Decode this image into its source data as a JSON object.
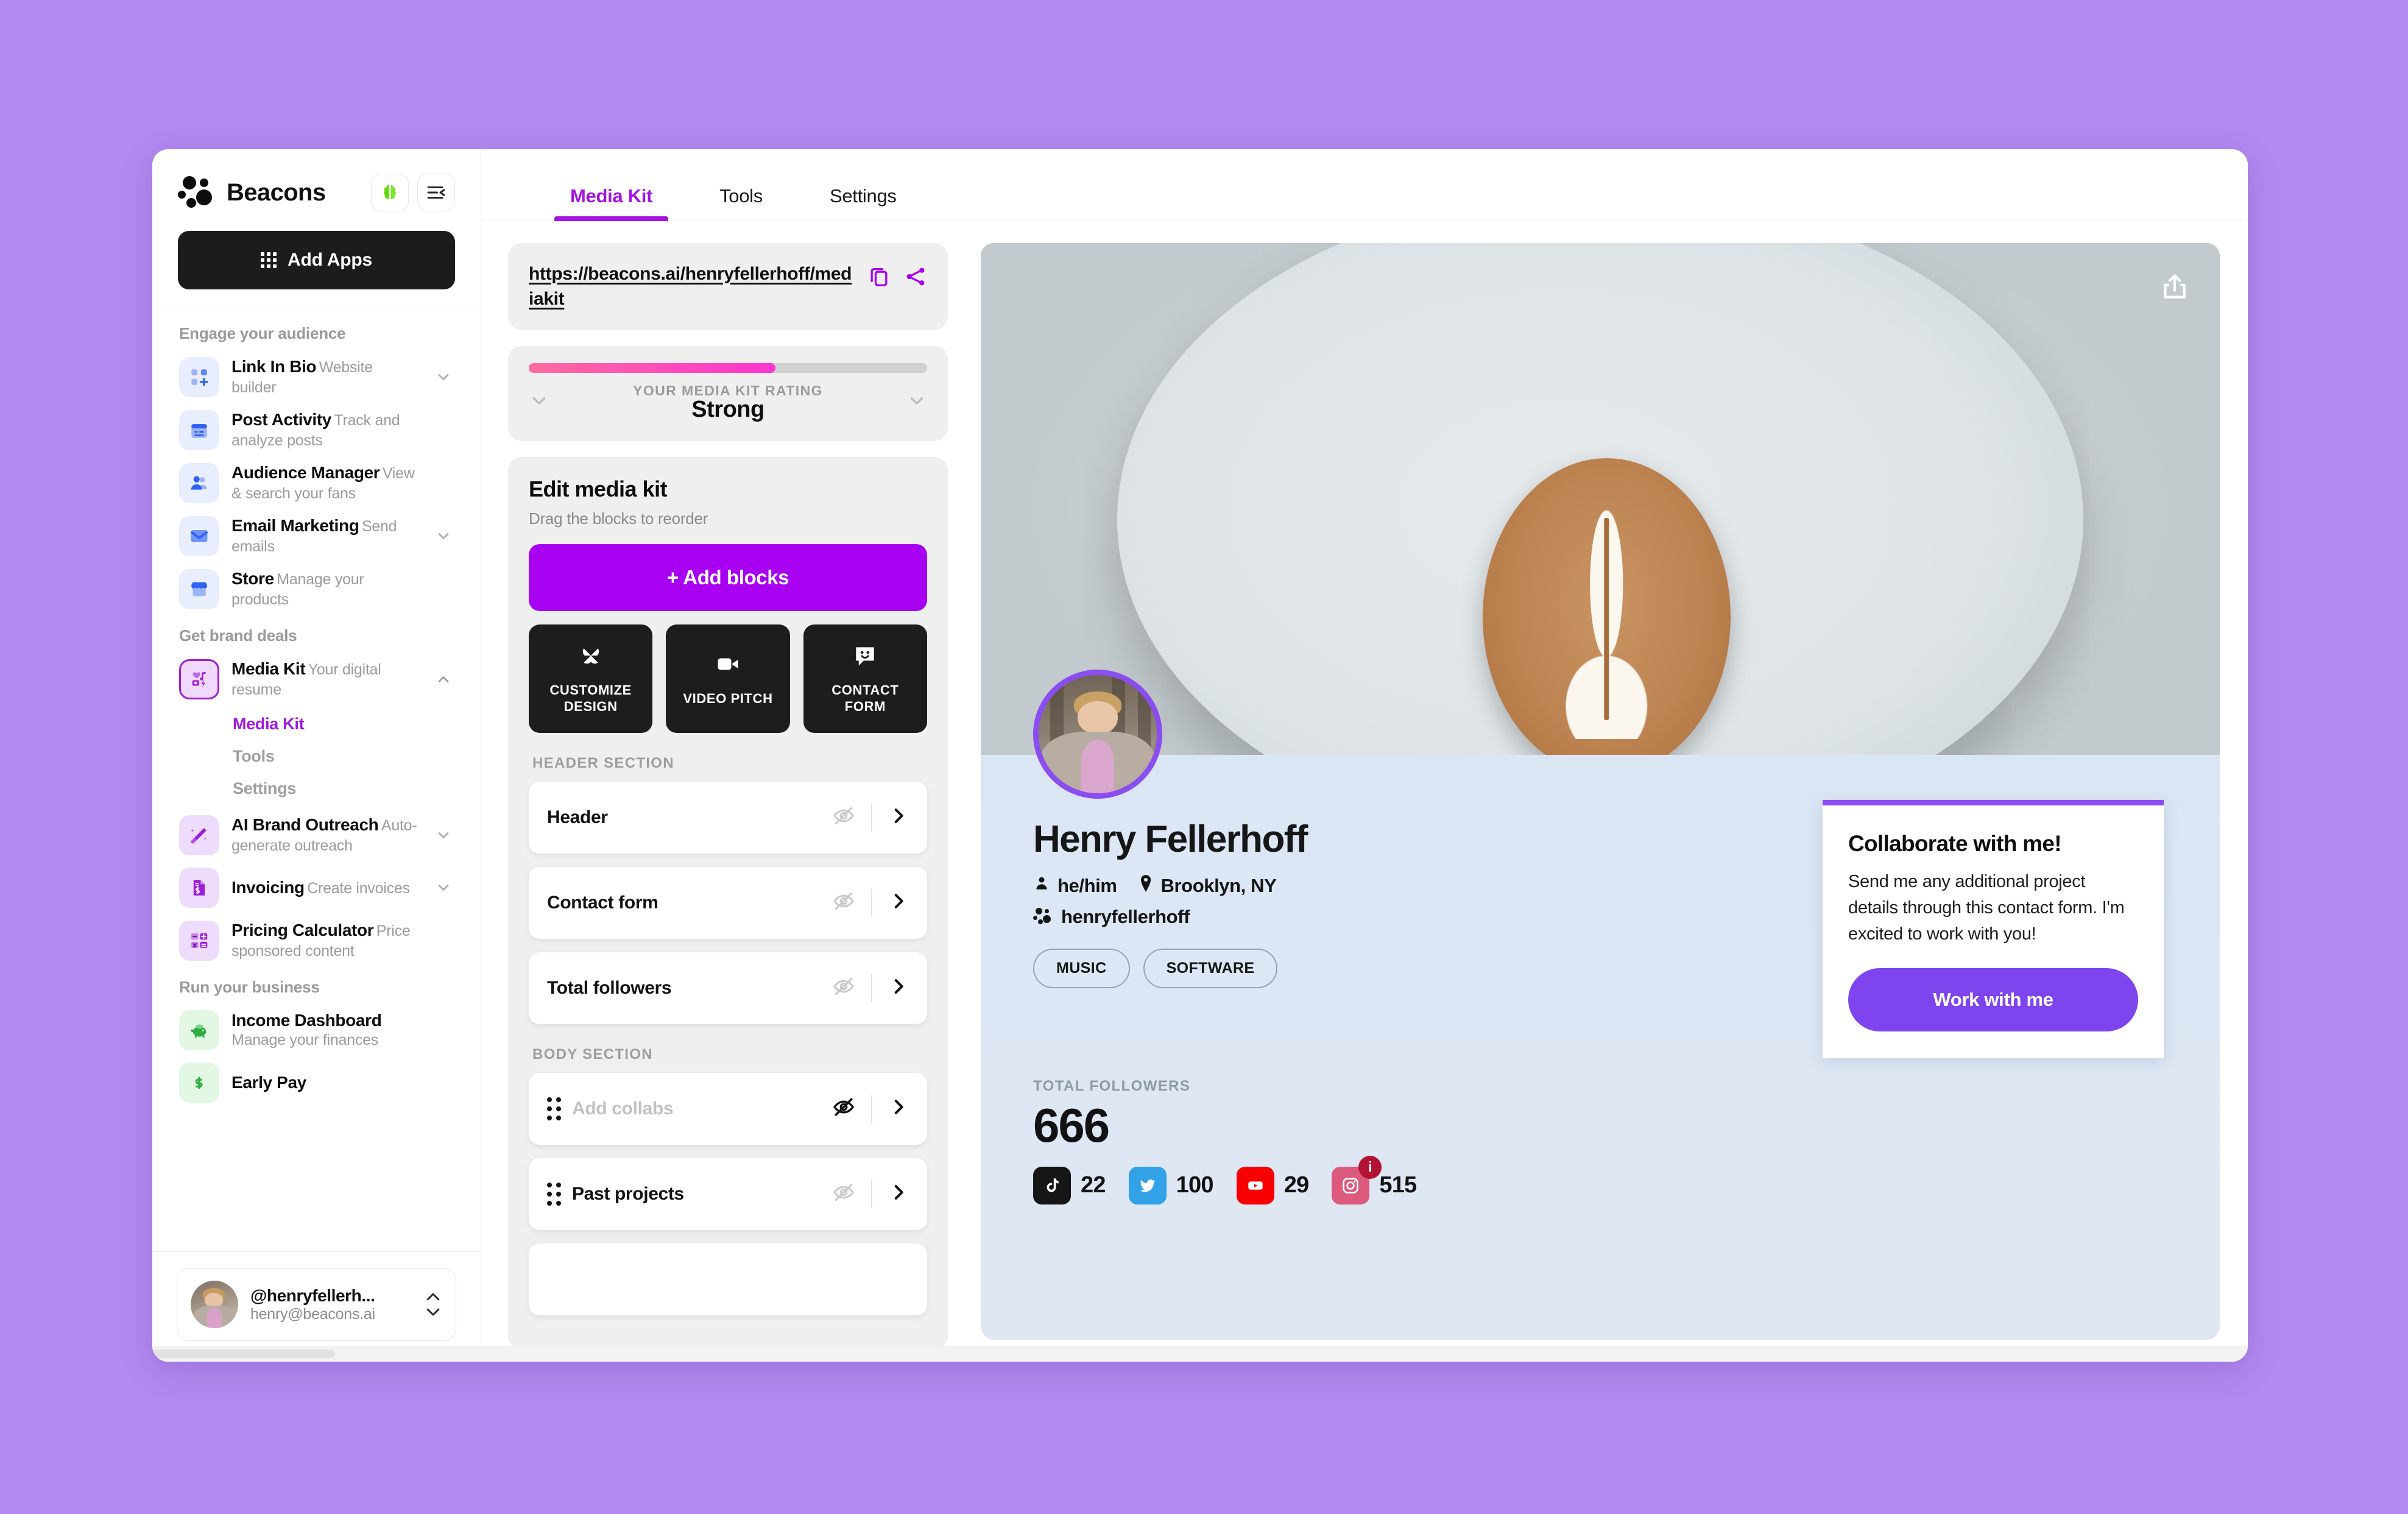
{
  "brand": {
    "name": "Beacons",
    "brain_icon": "brain-icon",
    "collapse_icon": "collapse-sidebar-icon"
  },
  "add_apps": {
    "label": "Add Apps",
    "icon": "grid-apps-icon"
  },
  "sidebar": {
    "groups": [
      {
        "title": "Engage your audience",
        "items": [
          {
            "label": "Link In Bio",
            "sub": "Website builder",
            "icon": "link-in-bio-icon",
            "tone": "blue",
            "chevron": "chevron-down-icon"
          },
          {
            "label": "Post Activity",
            "sub": "Track and analyze posts",
            "icon": "calendar-post-icon",
            "tone": "blue",
            "chevron": ""
          },
          {
            "label": "Audience Manager",
            "sub": "View & search your fans",
            "icon": "people-icon",
            "tone": "blue",
            "chevron": ""
          },
          {
            "label": "Email Marketing",
            "sub": "Send emails",
            "icon": "envelope-icon",
            "tone": "blue",
            "chevron": "chevron-down-icon"
          },
          {
            "label": "Store",
            "sub": "Manage your products",
            "icon": "storefront-icon",
            "tone": "blue",
            "chevron": ""
          }
        ]
      },
      {
        "title": "Get brand deals",
        "items": [
          {
            "label": "Media Kit",
            "sub": "Your digital resume",
            "icon": "media-kit-icon",
            "tone": "active",
            "chevron": "chevron-up-icon",
            "sublinks": [
              {
                "label": "Media Kit",
                "active": true
              },
              {
                "label": "Tools",
                "active": false
              },
              {
                "label": "Settings",
                "active": false
              }
            ]
          },
          {
            "label": "AI Brand Outreach",
            "sub": "Auto-generate outreach",
            "icon": "magic-wand-icon",
            "tone": "purple",
            "chevron": "chevron-down-icon"
          },
          {
            "label": "Invoicing",
            "sub": "Create invoices",
            "icon": "invoice-icon",
            "tone": "purple",
            "chevron": "chevron-down-icon"
          },
          {
            "label": "Pricing Calculator",
            "sub": "Price sponsored content",
            "icon": "calculator-icon",
            "tone": "purple",
            "chevron": ""
          }
        ]
      },
      {
        "title": "Run your business",
        "items": [
          {
            "label": "Income Dashboard",
            "sub": "Manage your finances",
            "icon": "piggy-bank-icon",
            "tone": "green",
            "chevron": ""
          },
          {
            "label": "Early Pay",
            "sub": "",
            "icon": "dollar-icon",
            "tone": "green",
            "chevron": ""
          }
        ]
      }
    ],
    "user": {
      "handle": "@henryfellerh...",
      "email": "henry@beacons.ai",
      "avatar": "user-avatar",
      "stepper_icon": "up-down-chevrons-icon"
    }
  },
  "tabs": [
    {
      "label": "Media Kit",
      "active": true
    },
    {
      "label": "Tools",
      "active": false
    },
    {
      "label": "Settings",
      "active": false
    }
  ],
  "editor": {
    "url": "https://beacons.ai/henryfellerhoff/mediakit",
    "copy_icon": "copy-icon",
    "share_icon": "share-nodes-icon",
    "rating": {
      "label": "YOUR MEDIA KIT RATING",
      "value": "Strong",
      "percent": 62,
      "left_icon": "chevron-down-icon",
      "right_icon": "chevron-down-icon"
    },
    "edit": {
      "title": "Edit media kit",
      "subtitle": "Drag the blocks to reorder",
      "add_blocks_label": "+ Add blocks",
      "quick_actions": [
        {
          "label": "CUSTOMIZE DESIGN",
          "icon": "brush-icon"
        },
        {
          "label": "VIDEO PITCH",
          "icon": "video-camera-icon"
        },
        {
          "label": "CONTACT FORM",
          "icon": "chat-smile-icon"
        }
      ]
    },
    "sections": [
      {
        "label": "HEADER SECTION",
        "blocks": [
          {
            "name": "Header",
            "draggable": false,
            "hidden_icon": "eye-slash-icon",
            "hidden_strong": false,
            "muted": false,
            "arrow_icon": "chevron-right-icon"
          },
          {
            "name": "Contact form",
            "draggable": false,
            "hidden_icon": "eye-slash-icon",
            "hidden_strong": false,
            "muted": false,
            "arrow_icon": "chevron-right-icon"
          },
          {
            "name": "Total followers",
            "draggable": false,
            "hidden_icon": "eye-slash-icon",
            "hidden_strong": false,
            "muted": false,
            "arrow_icon": "chevron-right-icon"
          }
        ]
      },
      {
        "label": "BODY SECTION",
        "blocks": [
          {
            "name": "Add collabs",
            "draggable": true,
            "hidden_icon": "eye-slash-icon",
            "hidden_strong": true,
            "muted": true,
            "arrow_icon": "chevron-right-icon"
          },
          {
            "name": "Past projects",
            "draggable": true,
            "hidden_icon": "eye-slash-icon",
            "hidden_strong": false,
            "muted": false,
            "arrow_icon": "chevron-right-icon"
          }
        ]
      }
    ]
  },
  "preview": {
    "share_icon": "share-upload-icon",
    "cover_image": "latte-coffee-cup-photo",
    "avatar": "profile-photo",
    "name": "Henry Fellerhoff",
    "pronouns": "he/him",
    "pronouns_icon": "person-icon",
    "location": "Brooklyn, NY",
    "location_icon": "map-pin-icon",
    "handle": "henryfellerhoff",
    "handle_icon": "beacons-logo-icon",
    "tags": [
      "MUSIC",
      "SOFTWARE"
    ],
    "followers": {
      "label": "TOTAL FOLLOWERS",
      "total": "666",
      "platforms": [
        {
          "name": "tiktok",
          "count": "22",
          "color": "#161616",
          "badge": ""
        },
        {
          "name": "twitter",
          "count": "100",
          "color": "#32a2e8",
          "badge": ""
        },
        {
          "name": "youtube",
          "count": "29",
          "color": "#f90000",
          "badge": ""
        },
        {
          "name": "instagram",
          "count": "515",
          "color": "#db5a7e",
          "badge": "i"
        }
      ]
    },
    "collab": {
      "title": "Collaborate with me!",
      "body": "Send me any additional project details through this contact form. I'm excited to work with you!",
      "button": "Work with me",
      "accent": "#8a4df0"
    }
  },
  "theme": {
    "accent_purple": "#a314e0",
    "page_bg": "#b289f0",
    "button_purple": "#a800f0"
  }
}
